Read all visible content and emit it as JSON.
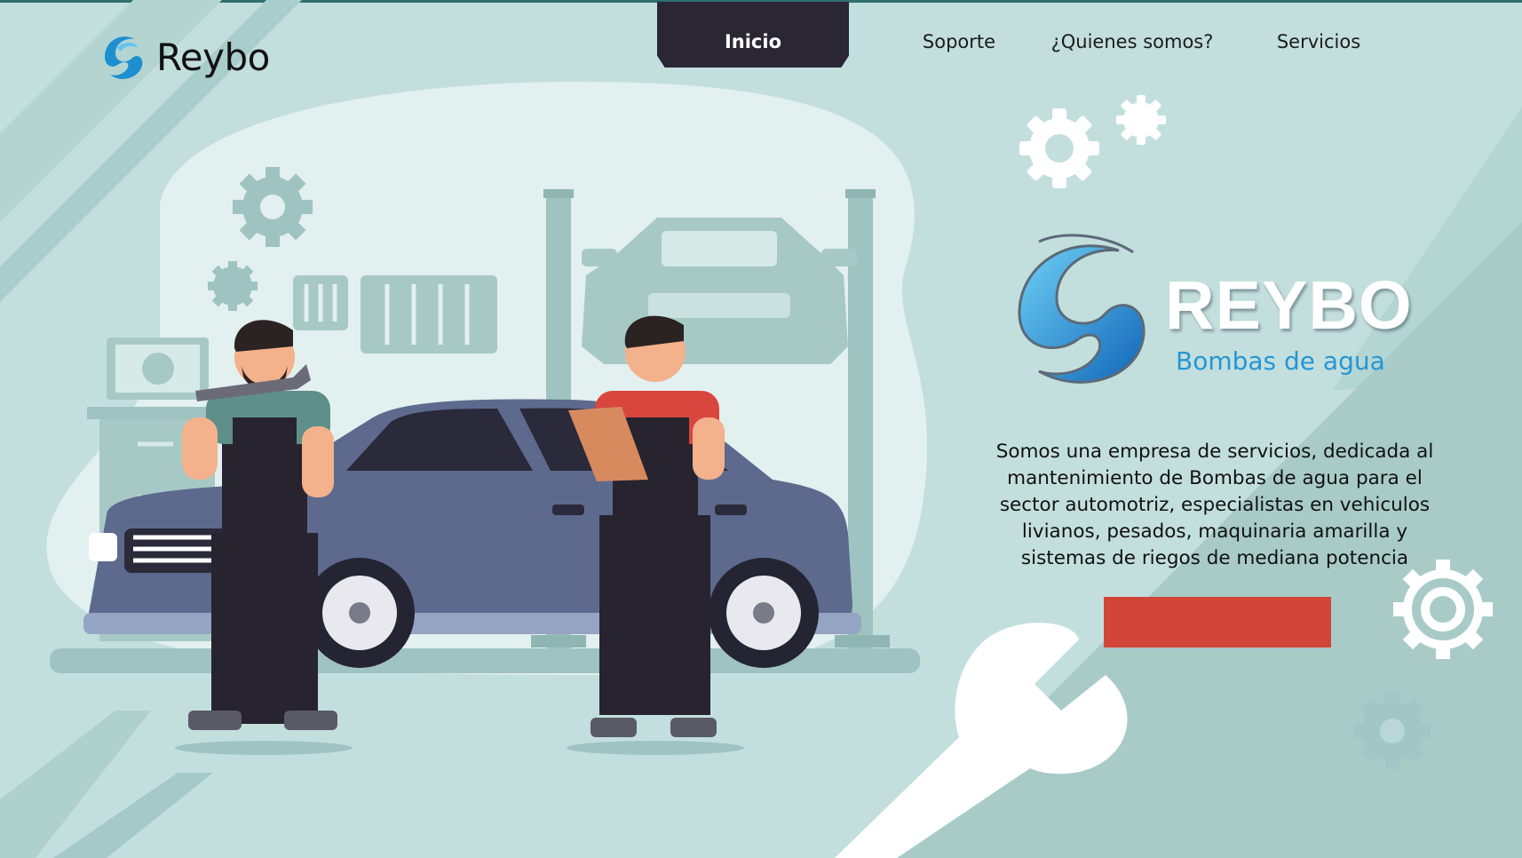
{
  "brand": {
    "name": "Reybo",
    "logo_icon": "reybo-swirl-icon"
  },
  "nav": {
    "items": [
      {
        "label": "Inicio",
        "active": true
      },
      {
        "label": "Soporte",
        "active": false
      },
      {
        "label": "¿Quienes somos?",
        "active": false
      },
      {
        "label": "Servicios",
        "active": false
      }
    ]
  },
  "hero": {
    "logo_word": "REYBO",
    "logo_tagline": "Bombas de agua",
    "description": "Somos una empresa de servicios, dedicada al mantenimiento de Bombas de agua para el sector automotriz, especialistas en vehiculos livianos, pesados, maquinaria amarilla y sistemas de riegos de mediana potencia",
    "cta_label": "",
    "illustration": "mechanics-garage-illustration"
  },
  "colors": {
    "background": "#c3dfdd",
    "nav_active": "#2a2634",
    "accent": "#2596d4",
    "cta": "#d2463a",
    "decor": "#9fc3c0"
  }
}
